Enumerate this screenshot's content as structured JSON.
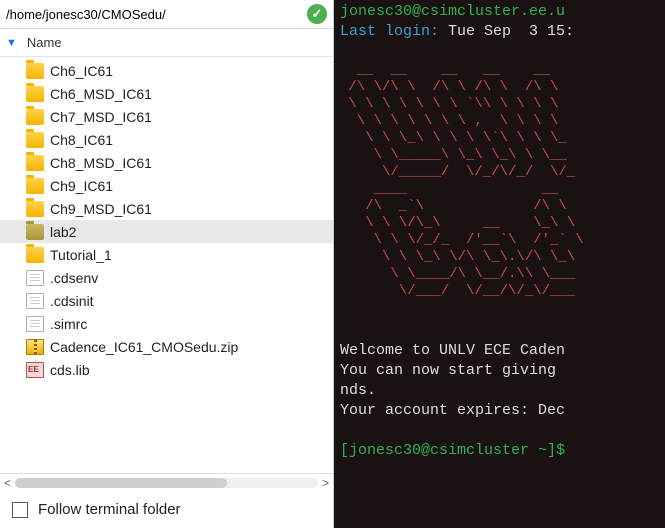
{
  "path": "/home/jonesc30/CMOSedu/",
  "columns": {
    "name": "Name"
  },
  "files": [
    {
      "type": "folder",
      "label": "Ch6_IC61"
    },
    {
      "type": "folder",
      "label": "Ch6_MSD_IC61"
    },
    {
      "type": "folder",
      "label": "Ch7_MSD_IC61"
    },
    {
      "type": "folder",
      "label": "Ch8_IC61"
    },
    {
      "type": "folder",
      "label": "Ch8_MSD_IC61"
    },
    {
      "type": "folder",
      "label": "Ch9_IC61"
    },
    {
      "type": "folder",
      "label": "Ch9_MSD_IC61"
    },
    {
      "type": "folder-open",
      "label": "lab2",
      "selected": true
    },
    {
      "type": "folder",
      "label": "Tutorial_1"
    },
    {
      "type": "file",
      "label": ".cdsenv"
    },
    {
      "type": "file",
      "label": ".cdsinit"
    },
    {
      "type": "file",
      "label": ".simrc"
    },
    {
      "type": "zip",
      "label": "Cadence_IC61_CMOSedu.zip"
    },
    {
      "type": "lib",
      "label": "cds.lib"
    }
  ],
  "follow_label": "Follow terminal folder",
  "terminal": {
    "userhost": "jonesc30@csimcluster.ee.u",
    "last_login_label": "Last login:",
    "last_login_value": " Tue Sep  3 15:",
    "ascii_art": "  __  __    __   __    __\n /\\ \\/\\ \\  /\\ \\ /\\ \\  /\\ \\\n \\ \\ \\ \\ \\ \\ \\ `\\\\ \\ \\ \\ \\\n  \\ \\ \\ \\ \\ \\ \\ ,  \\ \\ \\ \\\n   \\ \\ \\_\\ \\ \\ \\ \\`\\ \\ \\ \\_\n    \\ \\_____\\ \\_\\ \\_\\ \\ \\__\n     \\/_____/  \\/_/\\/_/  \\/_\n    ____                __\n   /\\  _`\\             /\\ \\\n   \\ \\ \\/\\_\\     __    \\_\\ \\\n    \\ \\ \\/_/_  /'__`\\  /'_` \\\n     \\ \\ \\_\\ \\/\\ \\_\\.\\/\\ \\_\\\n      \\ \\____/\\ \\__/.\\\\ \\___\n       \\/___/  \\/__/\\/_\\/___",
    "welcome_l1": "Welcome to UNLV ECE Caden",
    "welcome_l2": "You can now start giving ",
    "welcome_l3": "nds.",
    "expires": "Your account expires: Dec ",
    "prompt": "[jonesc30@csimcluster ~]$"
  }
}
